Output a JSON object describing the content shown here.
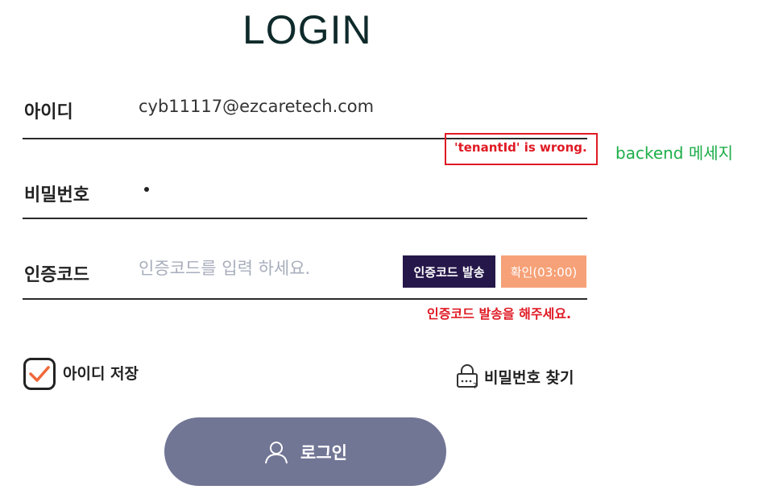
{
  "page": {
    "title": "LOGIN"
  },
  "id_field": {
    "label": "아이디",
    "value": "cyb11117@ezcaretech.com",
    "error": "'tenantId' is wrong.",
    "annotation": "backend 메세지"
  },
  "password_field": {
    "label": "비밀번호",
    "masked_char_count": 1
  },
  "auth_code_field": {
    "label": "인증코드",
    "value": "",
    "placeholder": "인증코드를 입력 하세요.",
    "send_button": "인증코드 발송",
    "confirm_button": "확인(03:00)",
    "error": "인증코드 발송을 해주세요."
  },
  "remember_id": {
    "label": "아이디 저장",
    "checked": true
  },
  "find_password": {
    "label": "비밀번호 찾기",
    "icon": "lock-icon"
  },
  "login_button": {
    "label": "로그인",
    "icon": "user-icon"
  },
  "colors": {
    "error": "#e01a24",
    "annotation": "#1fae4a",
    "send_button_bg": "#25174a",
    "confirm_button_bg": "#f6a178",
    "login_button_bg": "#727695",
    "checkbox_check": "#f0673a"
  }
}
